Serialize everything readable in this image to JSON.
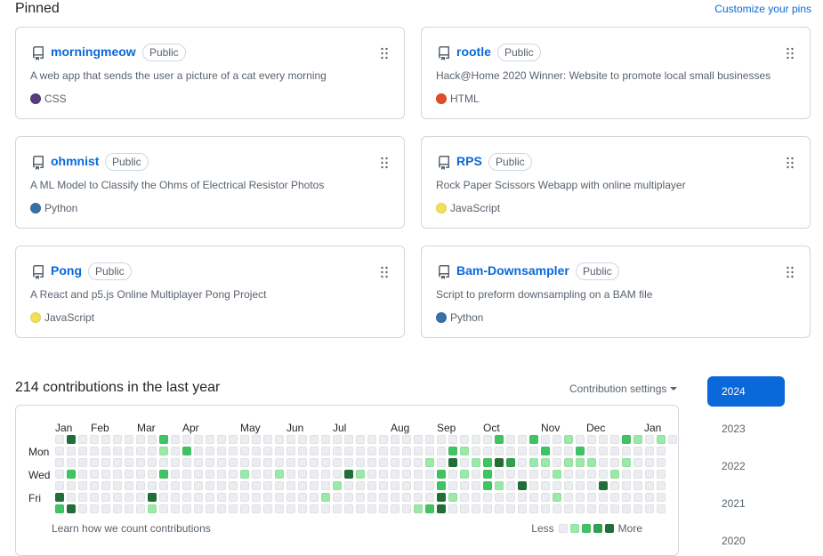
{
  "pinned": {
    "title": "Pinned",
    "customize_label": "Customize your pins",
    "cards": [
      {
        "name": "morningmeow",
        "badge": "Public",
        "description": "A web app that sends the user a picture of a cat every morning",
        "language": "CSS",
        "lang_color": "#563d7c"
      },
      {
        "name": "rootle",
        "badge": "Public",
        "description": "Hack@Home 2020 Winner: Website to promote local small businesses",
        "language": "HTML",
        "lang_color": "#e34c26"
      },
      {
        "name": "ohmnist",
        "badge": "Public",
        "description": "A ML Model to Classify the Ohms of Electrical Resistor Photos",
        "language": "Python",
        "lang_color": "#3572A5"
      },
      {
        "name": "RPS",
        "badge": "Public",
        "description": "Rock Paper Scissors Webapp with online multiplayer",
        "language": "JavaScript",
        "lang_color": "#f1e05a"
      },
      {
        "name": "Pong",
        "badge": "Public",
        "description": "A React and p5.js Online Multiplayer Pong Project",
        "language": "JavaScript",
        "lang_color": "#f1e05a"
      },
      {
        "name": "Bam-Downsampler",
        "badge": "Public",
        "description": "Script to preform downsampling on a BAM file",
        "language": "Python",
        "lang_color": "#3572A5"
      }
    ]
  },
  "contributions": {
    "title": "214 contributions in the last year",
    "settings_label": "Contribution settings",
    "months": [
      "Jan",
      "Feb",
      "Mar",
      "Apr",
      "May",
      "Jun",
      "Jul",
      "Aug",
      "Sep",
      "Oct",
      "Nov",
      "Dec",
      "Jan"
    ],
    "days": [
      "Mon",
      "Wed",
      "Fri"
    ],
    "learn_label": "Learn how we count contributions",
    "legend_less": "Less",
    "legend_more": "More",
    "level_colors": [
      "#ebedf0",
      "#9be9a8",
      "#40c463",
      "#30a14e",
      "#216e39"
    ],
    "active": [
      {
        "week": 0,
        "day": 5,
        "level": 4
      },
      {
        "week": 0,
        "day": 6,
        "level": 2
      },
      {
        "week": 1,
        "day": 0,
        "level": 4
      },
      {
        "week": 1,
        "day": 3,
        "level": 2
      },
      {
        "week": 1,
        "day": 6,
        "level": 4
      },
      {
        "week": 8,
        "day": 5,
        "level": 4
      },
      {
        "week": 8,
        "day": 6,
        "level": 1
      },
      {
        "week": 9,
        "day": 1,
        "level": 1
      },
      {
        "week": 9,
        "day": 0,
        "level": 2
      },
      {
        "week": 9,
        "day": 3,
        "level": 2
      },
      {
        "week": 11,
        "day": 1,
        "level": 2
      },
      {
        "week": 16,
        "day": 3,
        "level": 1
      },
      {
        "week": 19,
        "day": 3,
        "level": 1
      },
      {
        "week": 23,
        "day": 5,
        "level": 1
      },
      {
        "week": 24,
        "day": 4,
        "level": 1
      },
      {
        "week": 25,
        "day": 3,
        "level": 4
      },
      {
        "week": 26,
        "day": 3,
        "level": 1
      },
      {
        "week": 31,
        "day": 6,
        "level": 1
      },
      {
        "week": 32,
        "day": 2,
        "level": 1
      },
      {
        "week": 32,
        "day": 6,
        "level": 2
      },
      {
        "week": 33,
        "day": 3,
        "level": 2
      },
      {
        "week": 33,
        "day": 4,
        "level": 2
      },
      {
        "week": 33,
        "day": 5,
        "level": 4
      },
      {
        "week": 33,
        "day": 6,
        "level": 4
      },
      {
        "week": 34,
        "day": 1,
        "level": 2
      },
      {
        "week": 34,
        "day": 2,
        "level": 4
      },
      {
        "week": 34,
        "day": 5,
        "level": 1
      },
      {
        "week": 35,
        "day": 1,
        "level": 1
      },
      {
        "week": 35,
        "day": 3,
        "level": 1
      },
      {
        "week": 36,
        "day": 2,
        "level": 1
      },
      {
        "week": 37,
        "day": 2,
        "level": 2
      },
      {
        "week": 37,
        "day": 3,
        "level": 2
      },
      {
        "week": 37,
        "day": 4,
        "level": 2
      },
      {
        "week": 38,
        "day": 0,
        "level": 2
      },
      {
        "week": 38,
        "day": 2,
        "level": 4
      },
      {
        "week": 38,
        "day": 4,
        "level": 1
      },
      {
        "week": 39,
        "day": 2,
        "level": 3
      },
      {
        "week": 40,
        "day": 4,
        "level": 4
      },
      {
        "week": 41,
        "day": 0,
        "level": 2
      },
      {
        "week": 41,
        "day": 2,
        "level": 1
      },
      {
        "week": 42,
        "day": 2,
        "level": 1
      },
      {
        "week": 42,
        "day": 1,
        "level": 2
      },
      {
        "week": 43,
        "day": 3,
        "level": 1
      },
      {
        "week": 43,
        "day": 5,
        "level": 1
      },
      {
        "week": 44,
        "day": 0,
        "level": 1
      },
      {
        "week": 44,
        "day": 2,
        "level": 1
      },
      {
        "week": 45,
        "day": 1,
        "level": 2
      },
      {
        "week": 45,
        "day": 2,
        "level": 1
      },
      {
        "week": 46,
        "day": 2,
        "level": 1
      },
      {
        "week": 47,
        "day": 4,
        "level": 4
      },
      {
        "week": 48,
        "day": 3,
        "level": 1
      },
      {
        "week": 49,
        "day": 0,
        "level": 2
      },
      {
        "week": 49,
        "day": 2,
        "level": 1
      },
      {
        "week": 50,
        "day": 0,
        "level": 1
      },
      {
        "week": 52,
        "day": 0,
        "level": 1
      }
    ]
  },
  "years": [
    "2024",
    "2023",
    "2022",
    "2021",
    "2020"
  ],
  "active_year": "2024"
}
